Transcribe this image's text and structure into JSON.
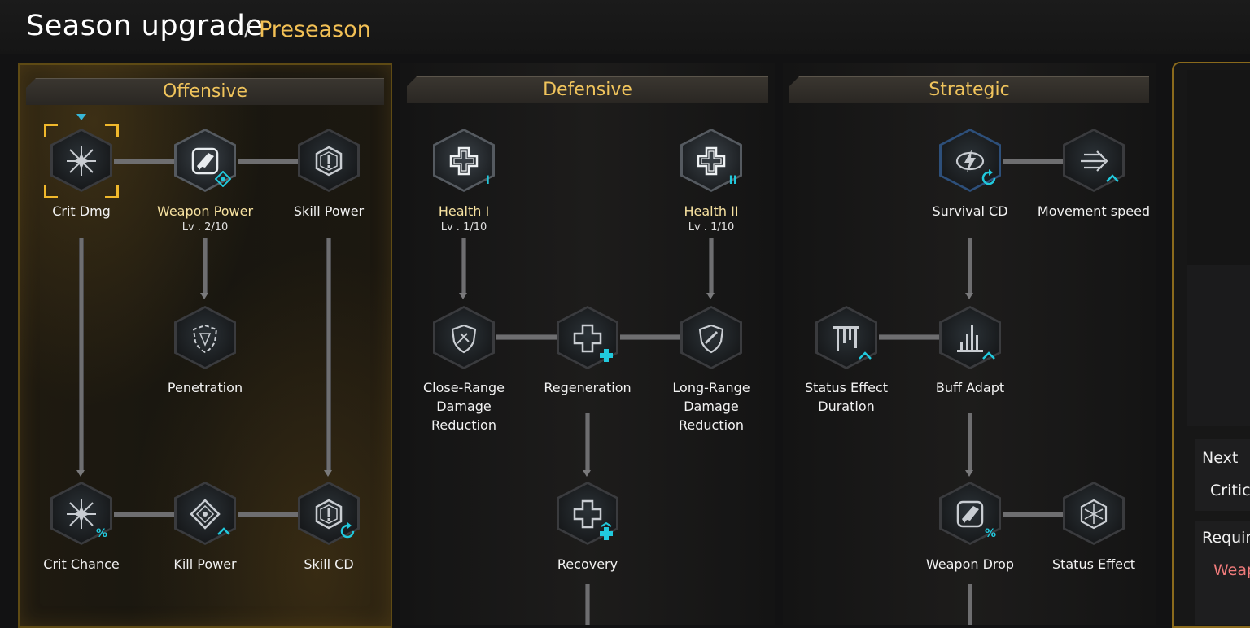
{
  "title": "Season upgrade",
  "title_separator": "/",
  "subtitle": "Preseason",
  "panels": {
    "offensive": "Offensive",
    "defensive": "Defensive",
    "strategic": "Strategic"
  },
  "nodes": {
    "crit_dmg": {
      "label": "Crit Dmg"
    },
    "weapon_power": {
      "label": "Weapon Power",
      "level": "Lv . 2/10"
    },
    "skill_power": {
      "label": "Skill Power"
    },
    "penetration": {
      "label": "Penetration"
    },
    "crit_chance": {
      "label": "Crit Chance",
      "badge": "%"
    },
    "kill_power": {
      "label": "Kill Power"
    },
    "skill_cd": {
      "label": "Skill CD"
    },
    "health_1": {
      "label": "Health I",
      "level": "Lv . 1/10",
      "badge": "I"
    },
    "health_2": {
      "label": "Health II",
      "level": "Lv . 1/10",
      "badge": "II"
    },
    "close_range": {
      "label1": "Close-Range",
      "label2": "Damage",
      "label3": "Reduction"
    },
    "regeneration": {
      "label": "Regeneration"
    },
    "long_range": {
      "label1": "Long-Range",
      "label2": "Damage",
      "label3": "Reduction"
    },
    "recovery": {
      "label": "Recovery"
    },
    "survival_cd": {
      "label": "Survival CD"
    },
    "movement_speed": {
      "label": "Movement speed"
    },
    "status_effect_duration": {
      "label1": "Status Effect",
      "label2": "Duration"
    },
    "buff_adapt": {
      "label": "Buff Adapt"
    },
    "weapon_drop": {
      "label": "Weapon Drop",
      "badge": "%"
    },
    "status_effect": {
      "label": "Status Effect"
    }
  },
  "side_panel": {
    "next_label": "Next",
    "next_value": "Critica",
    "require_label": "Requir",
    "require_value": "Weap"
  },
  "colors": {
    "header_gold": "#f0c45c",
    "subtitle_gold": "#f2c055",
    "accent_teal": "#21c9dd",
    "require_red": "#f07b7b"
  }
}
